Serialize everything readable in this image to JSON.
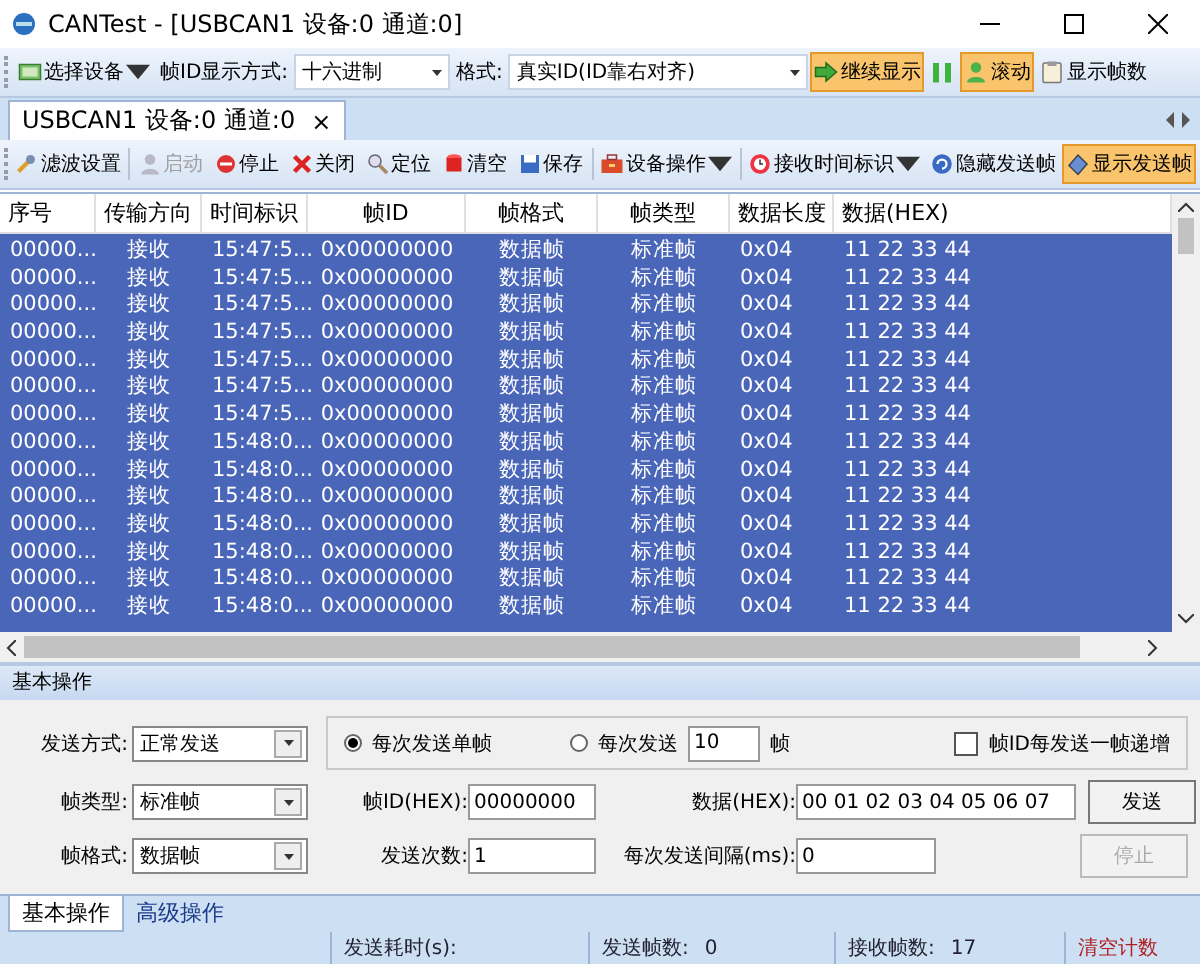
{
  "window": {
    "title": "CANTest  - [USBCAN1 设备:0 通道:0]"
  },
  "toolbar": [
    {
      "kind": "button",
      "label": "选择设备",
      "dropdown": true,
      "pressed": false
    },
    {
      "kind": "label",
      "label": "帧ID显示方式:"
    },
    {
      "kind": "select",
      "value": "十六进制"
    },
    {
      "kind": "label",
      "label": "格式:"
    },
    {
      "kind": "select",
      "value": "真实ID(ID靠右对齐)"
    },
    {
      "kind": "button",
      "label": "继续显示",
      "dropdown": false,
      "pressed": true
    },
    {
      "kind": "icon-button",
      "pressed": false
    },
    {
      "kind": "button",
      "label": "滚动",
      "dropdown": false,
      "pressed": true
    },
    {
      "kind": "button",
      "label": "显示帧数",
      "dropdown": false,
      "pressed": false
    }
  ],
  "document_tabs": [
    {
      "label": "USBCAN1 设备:0 通道:0",
      "close": "×",
      "selected": true
    }
  ],
  "device_toolbar": [
    {
      "kind": "button",
      "label": "滤波设置",
      "dropdown": false,
      "pressed": false,
      "disabled": false
    },
    {
      "kind": "button",
      "label": "启动",
      "dropdown": false,
      "pressed": false,
      "disabled": true
    },
    {
      "kind": "button",
      "label": "停止",
      "dropdown": false,
      "pressed": false,
      "disabled": false
    },
    {
      "kind": "button",
      "label": "关闭",
      "dropdown": false,
      "pressed": false,
      "disabled": false
    },
    {
      "kind": "button",
      "label": "定位",
      "dropdown": false,
      "pressed": false,
      "disabled": false
    },
    {
      "kind": "button",
      "label": "清空",
      "dropdown": false,
      "pressed": false,
      "disabled": false
    },
    {
      "kind": "button",
      "label": "保存",
      "dropdown": false,
      "pressed": false,
      "disabled": false
    },
    {
      "kind": "button",
      "label": "设备操作",
      "dropdown": true,
      "pressed": false,
      "disabled": false
    },
    {
      "kind": "button",
      "label": "接收时间标识",
      "dropdown": true,
      "pressed": false,
      "disabled": false
    },
    {
      "kind": "button",
      "label": "隐藏发送帧",
      "dropdown": false,
      "pressed": false,
      "disabled": false
    },
    {
      "kind": "button",
      "label": "显示发送帧",
      "dropdown": false,
      "pressed": true,
      "disabled": false
    }
  ],
  "table": {
    "columns": [
      "序号",
      "传输方向",
      "时间标识",
      "帧ID",
      "帧格式",
      "帧类型",
      "数据长度",
      "数据(HEX)"
    ],
    "rows": [
      {
        "selected": true,
        "cells": [
          "00000...",
          "接收",
          "15:47:5...",
          "0x00000000",
          "数据帧",
          "标准帧",
          "0x04",
          "11 22 33 44"
        ]
      },
      {
        "selected": true,
        "cells": [
          "00000...",
          "接收",
          "15:47:5...",
          "0x00000000",
          "数据帧",
          "标准帧",
          "0x04",
          "11 22 33 44"
        ]
      },
      {
        "selected": true,
        "cells": [
          "00000...",
          "接收",
          "15:47:5...",
          "0x00000000",
          "数据帧",
          "标准帧",
          "0x04",
          "11 22 33 44"
        ]
      },
      {
        "selected": true,
        "cells": [
          "00000...",
          "接收",
          "15:47:5...",
          "0x00000000",
          "数据帧",
          "标准帧",
          "0x04",
          "11 22 33 44"
        ]
      },
      {
        "selected": true,
        "cells": [
          "00000...",
          "接收",
          "15:47:5...",
          "0x00000000",
          "数据帧",
          "标准帧",
          "0x04",
          "11 22 33 44"
        ]
      },
      {
        "selected": true,
        "cells": [
          "00000...",
          "接收",
          "15:47:5...",
          "0x00000000",
          "数据帧",
          "标准帧",
          "0x04",
          "11 22 33 44"
        ]
      },
      {
        "selected": true,
        "cells": [
          "00000...",
          "接收",
          "15:47:5...",
          "0x00000000",
          "数据帧",
          "标准帧",
          "0x04",
          "11 22 33 44"
        ]
      },
      {
        "selected": true,
        "cells": [
          "00000...",
          "接收",
          "15:48:0...",
          "0x00000000",
          "数据帧",
          "标准帧",
          "0x04",
          "11 22 33 44"
        ]
      },
      {
        "selected": true,
        "cells": [
          "00000...",
          "接收",
          "15:48:0...",
          "0x00000000",
          "数据帧",
          "标准帧",
          "0x04",
          "11 22 33 44"
        ]
      },
      {
        "selected": true,
        "cells": [
          "00000...",
          "接收",
          "15:48:0...",
          "0x00000000",
          "数据帧",
          "标准帧",
          "0x04",
          "11 22 33 44"
        ]
      },
      {
        "selected": true,
        "cells": [
          "00000...",
          "接收",
          "15:48:0...",
          "0x00000000",
          "数据帧",
          "标准帧",
          "0x04",
          "11 22 33 44"
        ]
      },
      {
        "selected": true,
        "cells": [
          "00000...",
          "接收",
          "15:48:0...",
          "0x00000000",
          "数据帧",
          "标准帧",
          "0x04",
          "11 22 33 44"
        ]
      },
      {
        "selected": true,
        "cells": [
          "00000...",
          "接收",
          "15:48:0...",
          "0x00000000",
          "数据帧",
          "标准帧",
          "0x04",
          "11 22 33 44"
        ]
      },
      {
        "selected": true,
        "cells": [
          "00000...",
          "接收",
          "15:48:0...",
          "0x00000000",
          "数据帧",
          "标准帧",
          "0x04",
          "11 22 33 44"
        ]
      }
    ]
  },
  "send_panel": {
    "title": "基本操作",
    "send_mode": {
      "label": "发送方式:",
      "value": "正常发送"
    },
    "frame_type": {
      "label": "帧类型:",
      "value": "标准帧"
    },
    "frame_format": {
      "label": "帧格式:",
      "value": "数据帧"
    },
    "send_options": [
      {
        "label": "每次发送单帧",
        "selected": true
      },
      {
        "label": "每次发送",
        "selected": false
      }
    ],
    "frame_count": {
      "value": "10",
      "suffix": "帧"
    },
    "increment_id": {
      "label": "帧ID每发送一帧递增",
      "checked": false
    },
    "frame_id": {
      "label": "帧ID(HEX):",
      "value": "00000000"
    },
    "data": {
      "label": "数据(HEX):",
      "value": "00 01 02 03 04 05 06 07"
    },
    "send_times": {
      "label": "发送次数:",
      "value": "1"
    },
    "interval": {
      "label": "每次发送间隔(ms):",
      "value": "0"
    },
    "buttons": [
      {
        "label": "发送",
        "disabled": false
      },
      {
        "label": "停止",
        "disabled": true
      }
    ]
  },
  "bottom_tabs": [
    {
      "label": "基本操作",
      "selected": true
    },
    {
      "label": "高级操作",
      "selected": false
    }
  ],
  "status_bar": [
    {
      "kind": "field",
      "label": "发送耗时(s):"
    },
    {
      "kind": "field",
      "label": "发送帧数:",
      "value": "0"
    },
    {
      "kind": "field",
      "label": "接收帧数:",
      "value": "17"
    },
    {
      "kind": "link",
      "label": "清空计数"
    }
  ]
}
